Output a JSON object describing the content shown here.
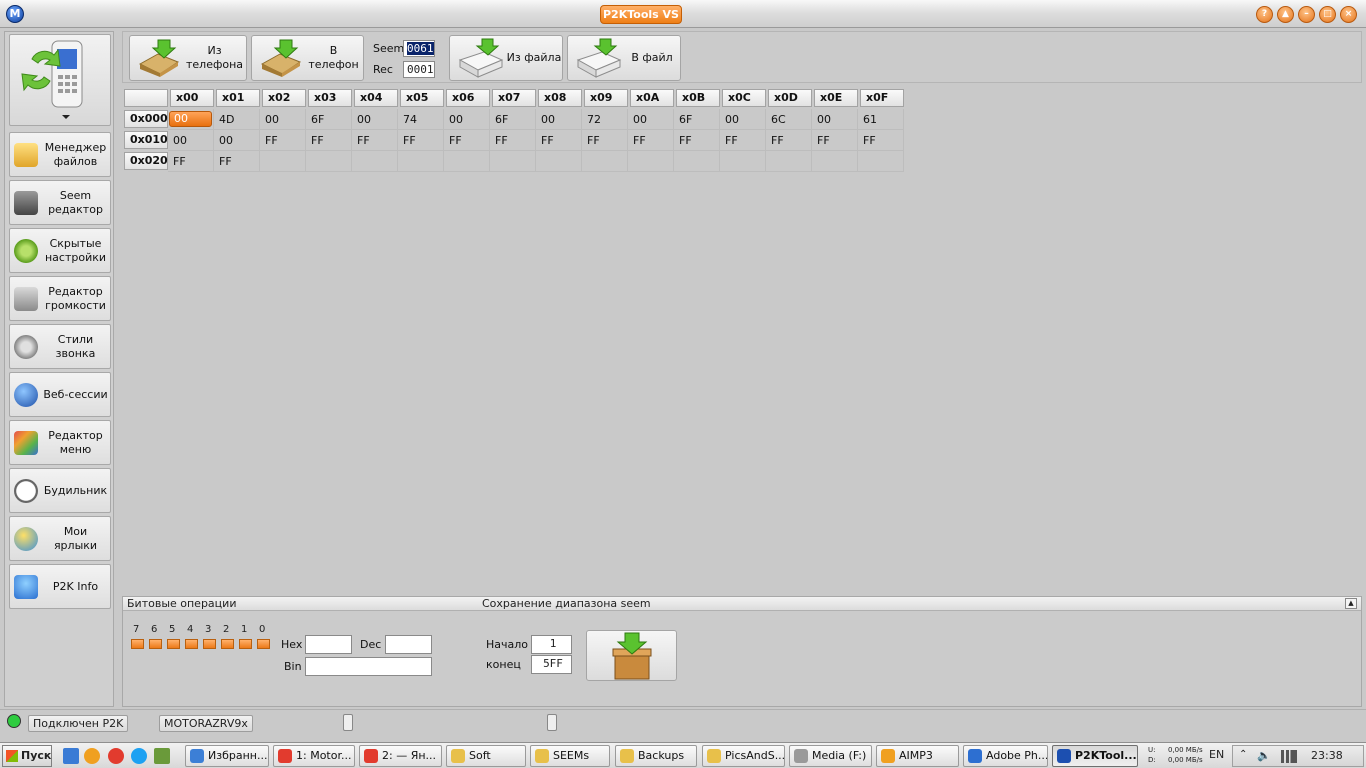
{
  "window": {
    "title": "P2KTools VS"
  },
  "window_buttons": [
    "help",
    "restore-up",
    "minimize",
    "maximize",
    "close"
  ],
  "sidebar": {
    "items": [
      {
        "label": "Менеджер файлов",
        "icon": "file-manager-icon"
      },
      {
        "label": "Seem редактор",
        "icon": "seem-editor-icon"
      },
      {
        "label": "Скрытые настройки",
        "icon": "gear-icon"
      },
      {
        "label": "Редактор громкости",
        "icon": "volume-icon"
      },
      {
        "label": "Стили звонка",
        "icon": "ring-style-icon"
      },
      {
        "label": "Веб-сессии",
        "icon": "globe-icon"
      },
      {
        "label": "Редактор меню",
        "icon": "menu-editor-icon"
      },
      {
        "label": "Будильник",
        "icon": "clock-icon"
      },
      {
        "label": "Мои ярлыки",
        "icon": "shortcut-icon"
      },
      {
        "label": "P2K Info",
        "icon": "info-icon"
      }
    ]
  },
  "toolbar": {
    "from_phone": "Из телефона",
    "to_phone": "В телефон",
    "seem_label": "Seem",
    "seem_value": "0061",
    "rec_label": "Rec",
    "rec_value": "0001",
    "from_file": "Из файла",
    "to_file": "В файл"
  },
  "hex": {
    "columns": [
      "x00",
      "x01",
      "x02",
      "x03",
      "x04",
      "x05",
      "x06",
      "x07",
      "x08",
      "x09",
      "x0A",
      "x0B",
      "x0C",
      "x0D",
      "x0E",
      "x0F"
    ],
    "rows": [
      {
        "addr": "0x000",
        "cells": [
          "00",
          "4D",
          "00",
          "6F",
          "00",
          "74",
          "00",
          "6F",
          "00",
          "72",
          "00",
          "6F",
          "00",
          "6C",
          "00",
          "61"
        ]
      },
      {
        "addr": "0x010",
        "cells": [
          "00",
          "00",
          "FF",
          "FF",
          "FF",
          "FF",
          "FF",
          "FF",
          "FF",
          "FF",
          "FF",
          "FF",
          "FF",
          "FF",
          "FF",
          "FF"
        ]
      },
      {
        "addr": "0x020",
        "cells": [
          "FF",
          "FF",
          "",
          "",
          "",
          "",
          "",
          "",
          "",
          "",
          "",
          "",
          "",
          "",
          "",
          ""
        ]
      }
    ],
    "selected_cell": {
      "row": 0,
      "col": 0
    }
  },
  "bottom": {
    "bit_ops_title": "Битовые операции",
    "save_range_title": "Сохранение диапазона seem",
    "bits": [
      "7",
      "6",
      "5",
      "4",
      "3",
      "2",
      "1",
      "0"
    ],
    "hex_label": "Hex",
    "dec_label": "Dec",
    "bin_label": "Bin",
    "start_label": "Начало",
    "start_value": "1",
    "end_label": "конец",
    "end_value": "5FF"
  },
  "status": {
    "connection": "Подключен P2K",
    "model": "MOTORAZRV9x",
    "connection_color": "#2ecc40"
  },
  "taskbar": {
    "start": "Пуск",
    "tasks": [
      {
        "label": "Избранн...",
        "color": "#3c7fd6"
      },
      {
        "label": "1: Motor...",
        "color": "#e23b2e"
      },
      {
        "label": "2: — Ян...",
        "color": "#e23b2e"
      },
      {
        "label": "Soft",
        "color": "#e8c04a"
      },
      {
        "label": "SEEMs",
        "color": "#e8c04a"
      },
      {
        "label": "Backups",
        "color": "#e8c04a"
      },
      {
        "label": "PicsAndS...",
        "color": "#e8c04a"
      },
      {
        "label": "Media (F:)",
        "color": "#9a9a9a"
      },
      {
        "label": "AIMP3",
        "color": "#f0a020"
      },
      {
        "label": "Adobe Ph...",
        "color": "#2d6fd1"
      },
      {
        "label": "P2KTool...",
        "color": "#1c4fb0",
        "active": true
      }
    ],
    "net_up": "0,00 МБ/s",
    "net_down": "0,00 МБ/s",
    "net_u_label": "U:",
    "net_d_label": "D:",
    "lang": "EN",
    "time": "23:38"
  }
}
